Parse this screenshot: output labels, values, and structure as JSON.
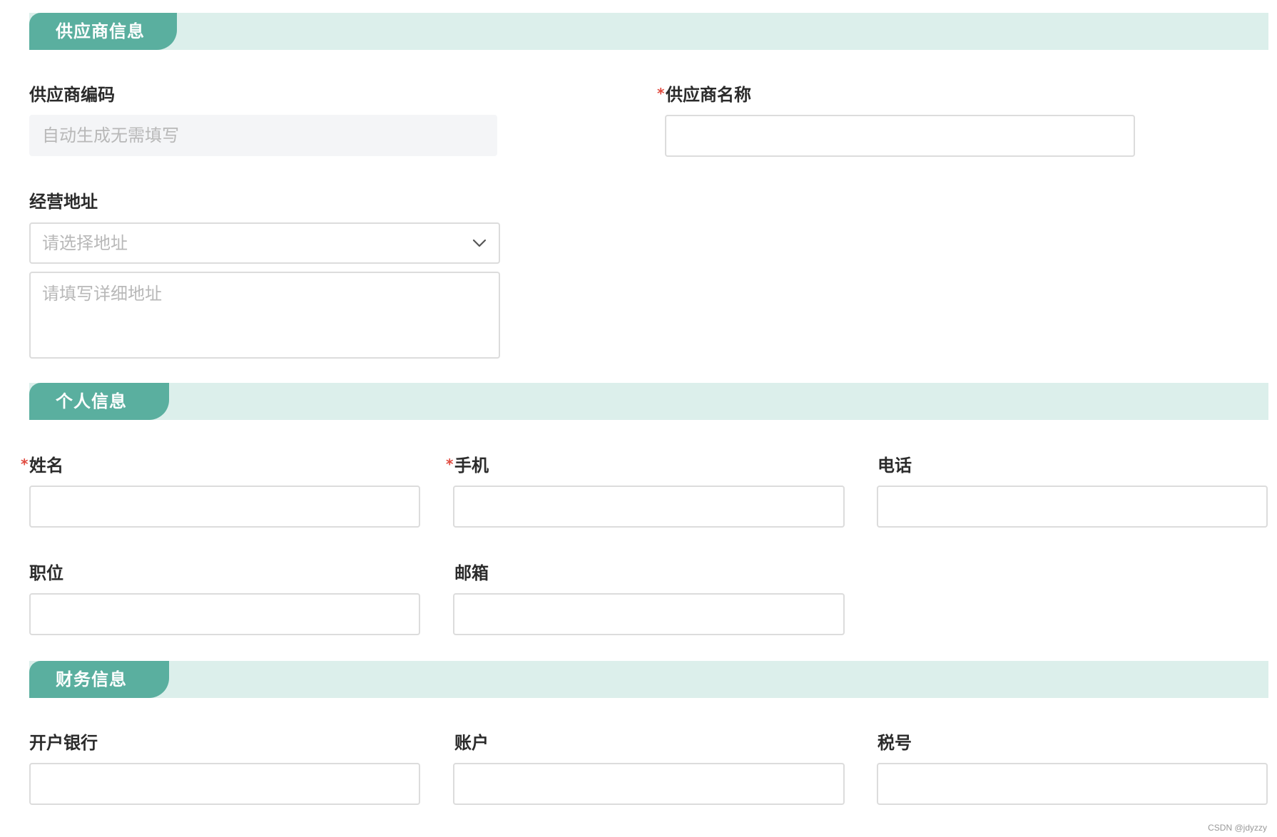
{
  "sections": {
    "supplier": {
      "title": "供应商信息",
      "supplier_code_label": "供应商编码",
      "supplier_code_placeholder": "自动生成无需填写",
      "supplier_name_label": "供应商名称",
      "supplier_name_required": "*",
      "address_label": "经营地址",
      "address_select_placeholder": "请选择地址",
      "address_detail_placeholder": "请填写详细地址"
    },
    "personal": {
      "title": "个人信息",
      "name_label": "姓名",
      "name_required": "*",
      "mobile_label": "手机",
      "mobile_required": "*",
      "phone_label": "电话",
      "position_label": "职位",
      "email_label": "邮箱"
    },
    "finance": {
      "title": "财务信息",
      "bank_label": "开户银行",
      "account_label": "账户",
      "tax_label": "税号"
    }
  },
  "watermark": "CSDN @jdyzzy",
  "colors": {
    "accent": "#5aaf9f",
    "section_bg": "#dcefeb",
    "required": "#e04a3f"
  },
  "icons": {
    "select_arrow": "chevron-down-icon"
  }
}
